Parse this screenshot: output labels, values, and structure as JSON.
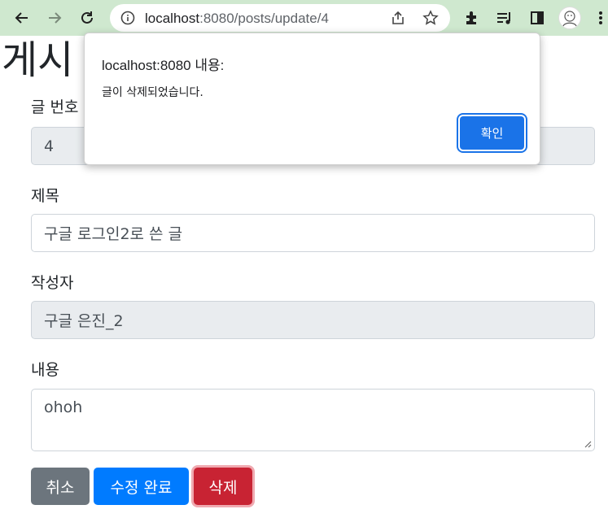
{
  "browser": {
    "url_host": "localhost",
    "url_rest": ":8080/posts/update/4"
  },
  "page": {
    "title": "게시",
    "fields": {
      "id": {
        "label": "글 번호",
        "value": "4"
      },
      "title": {
        "label": "제목",
        "value": "구글 로그인2로 쓴 글"
      },
      "author": {
        "label": "작성자",
        "value": "구글 은진_2"
      },
      "content": {
        "label": "내용",
        "value": "ohoh"
      }
    },
    "buttons": {
      "cancel": "취소",
      "update": "수정 완료",
      "delete": "삭제"
    }
  },
  "dialog": {
    "title": "localhost:8080 내용:",
    "message": "글이 삭제되었습니다.",
    "ok": "확인"
  },
  "colors": {
    "chrome_bg": "#cfe8cf",
    "btn_secondary": "#6c757d",
    "btn_primary": "#007bff",
    "btn_danger": "#c82333",
    "dialog_ok": "#1a73e8"
  }
}
